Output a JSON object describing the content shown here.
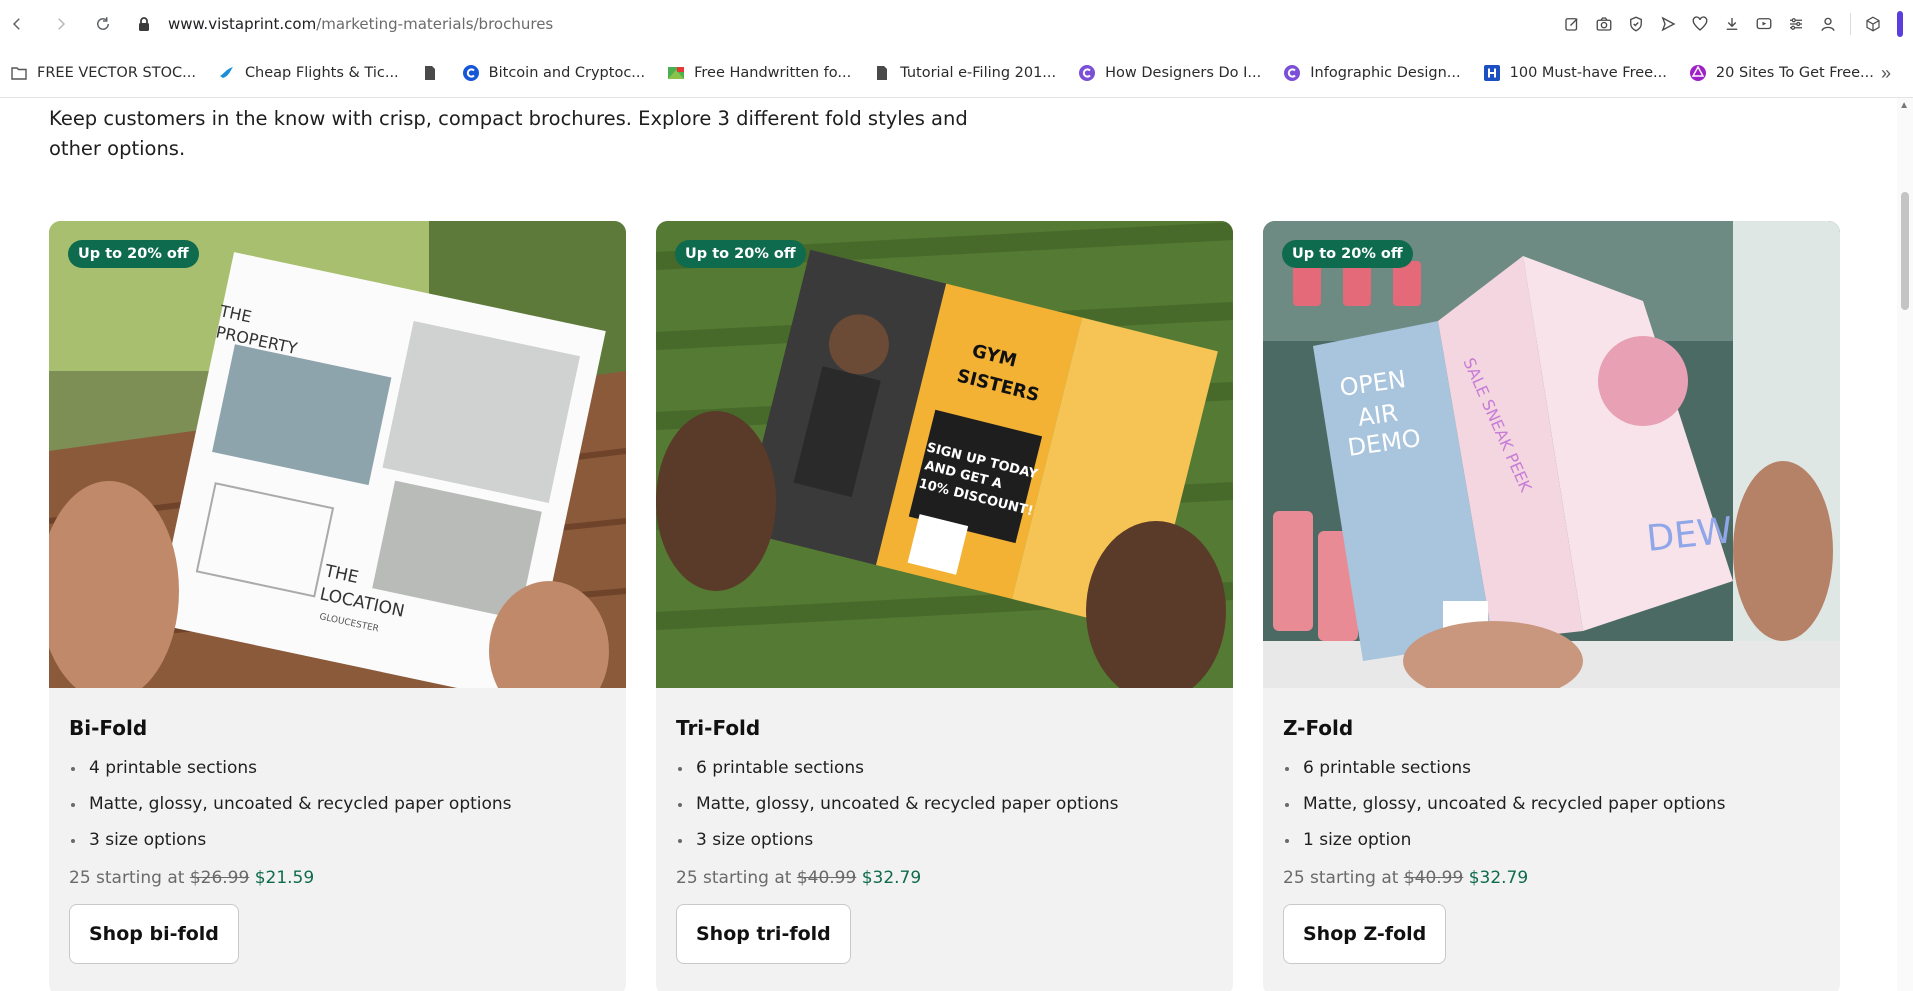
{
  "browser": {
    "url_host": "www.vistaprint.com",
    "url_path": "/marketing-materials/brochures",
    "bookmarks": [
      {
        "label": "FREE VECTOR STOC...",
        "icon": "folder-icon"
      },
      {
        "label": "Cheap Flights & Tic...",
        "icon": "bird-icon"
      },
      {
        "label": "",
        "icon": "file-icon"
      },
      {
        "label": "Bitcoin and Cryptoc...",
        "icon": "c-circle-icon"
      },
      {
        "label": "Free Handwritten fo...",
        "icon": "font-icon"
      },
      {
        "label": "Tutorial e-Filing 201...",
        "icon": "file-icon"
      },
      {
        "label": "How Designers Do I...",
        "icon": "c-circle-icon"
      },
      {
        "label": "Infographic Design...",
        "icon": "c-circle-icon"
      },
      {
        "label": "100 Must-have Free...",
        "icon": "h-square-icon"
      },
      {
        "label": "20 Sites To Get Free...",
        "icon": "sticker-icon"
      }
    ]
  },
  "page": {
    "intro": "Keep customers in the know with crisp, compact brochures. Explore 3 different fold styles and other options."
  },
  "cards": [
    {
      "badge": "Up to 20% off",
      "title": "Bi-Fold",
      "features": [
        "4 printable sections",
        "Matte, glossy, uncoated & recycled paper options",
        "3 size options"
      ],
      "price_prefix": "25 starting at",
      "price_old": "$26.99",
      "price_new": "$21.59",
      "button": "Shop bi-fold",
      "image_text": {
        "line1": "THE",
        "line2": "PROPERTY",
        "line3": "THE",
        "line4": "LOCATION",
        "line5": "GLOUCESTER"
      }
    },
    {
      "badge": "Up to 20% off",
      "title": "Tri-Fold",
      "features": [
        "6 printable sections",
        "Matte, glossy, uncoated & recycled paper options",
        "3 size options"
      ],
      "price_prefix": "25 starting at",
      "price_old": "$40.99",
      "price_new": "$32.79",
      "button": "Shop tri-fold",
      "image_text": {
        "line1": "GYM",
        "line2": "SISTERS",
        "line3": "SIGN UP TODAY",
        "line4": "AND GET A",
        "line5": "10% DISCOUNT!"
      }
    },
    {
      "badge": "Up to 20% off",
      "title": "Z-Fold",
      "features": [
        "6 printable sections",
        "Matte, glossy, uncoated & recycled paper options",
        "1 size option"
      ],
      "price_prefix": "25 starting at",
      "price_old": "$40.99",
      "price_new": "$32.79",
      "button": "Shop Z-fold",
      "image_text": {
        "line1": "OPEN",
        "line2": "AIR",
        "line3": "DEMO",
        "line4": "SALE SNEAK PEEK",
        "line5": "DEW"
      }
    }
  ]
}
